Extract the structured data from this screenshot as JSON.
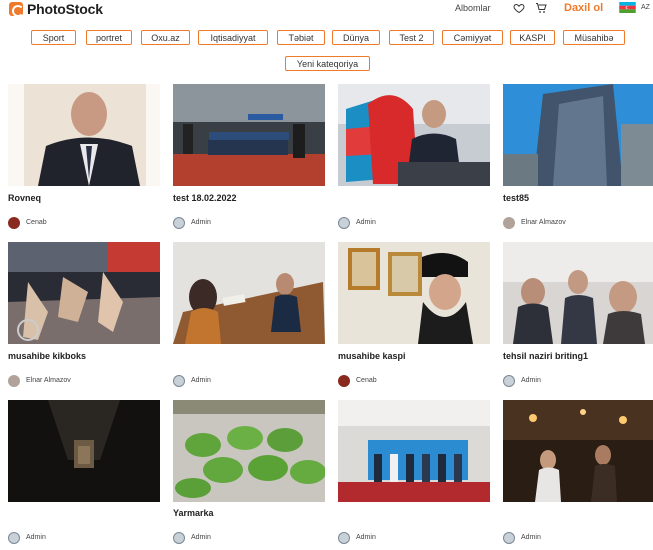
{
  "header": {
    "logo_text": "PhotoStock",
    "albums_label": "Albomlar",
    "login_label": "Daxil ol",
    "lang_label": "AZ",
    "icons": [
      "heart-icon",
      "cart-icon",
      "az-flag-icon"
    ],
    "accent_color": "#f07a2b"
  },
  "categories": [
    "Sport",
    "portret",
    "Oxu.az",
    "Iqtisadiyyat",
    "Təbiət",
    "Dünya",
    "Test 2",
    "Cəmiyyət",
    "KASPI",
    "Müsahibə",
    "Yeni kateqoriya"
  ],
  "photos": [
    {
      "title": "Rovneq",
      "author": "Cenab"
    },
    {
      "title": "test 18.02.2022",
      "author": "Admin"
    },
    {
      "title": "",
      "author": "Admin"
    },
    {
      "title": "test85",
      "author": "Elnar Almazov"
    },
    {
      "title": "musahibe kikboks",
      "author": "Elnar Almazov"
    },
    {
      "title": "",
      "author": "Admin"
    },
    {
      "title": "musahibe kaspi",
      "author": "Cenab"
    },
    {
      "title": "tehsil naziri briting1",
      "author": "Admin"
    },
    {
      "title": "",
      "author": "Admin"
    },
    {
      "title": "Yarmarka",
      "author": "Admin"
    },
    {
      "title": "",
      "author": "Admin"
    },
    {
      "title": "",
      "author": "Admin"
    }
  ]
}
